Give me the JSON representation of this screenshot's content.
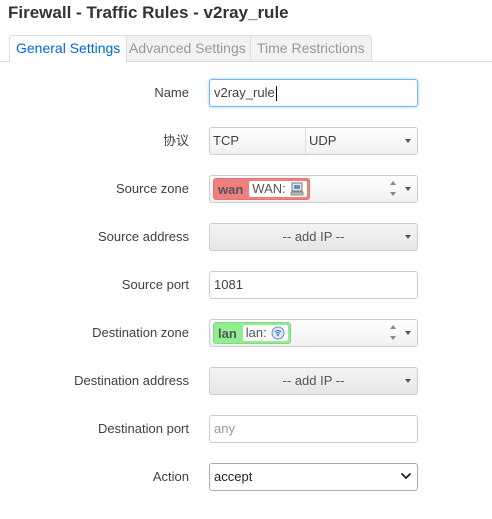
{
  "page": {
    "title": "Firewall - Traffic Rules - v2ray_rule"
  },
  "tabs": [
    {
      "label": "General Settings",
      "active": true
    },
    {
      "label": "Advanced Settings",
      "active": false
    },
    {
      "label": "Time Restrictions",
      "active": false
    }
  ],
  "form": {
    "name": {
      "label": "Name",
      "value": "v2ray_rule"
    },
    "protocol": {
      "label": "协议",
      "options": [
        "TCP",
        "UDP"
      ]
    },
    "source_zone": {
      "label": "Source zone",
      "zone": "wan",
      "networks": "WAN:",
      "icon": "network-port-icon",
      "color": "#f08080"
    },
    "source_address": {
      "label": "Source address",
      "value": "-- add IP --"
    },
    "source_port": {
      "label": "Source port",
      "value": "1081"
    },
    "destination_zone": {
      "label": "Destination zone",
      "zone": "lan",
      "networks": "lan:",
      "icon": "wireless-icon",
      "color": "#90ee90"
    },
    "destination_address": {
      "label": "Destination address",
      "value": "-- add IP --"
    },
    "destination_port": {
      "label": "Destination port",
      "placeholder": "any"
    },
    "action": {
      "label": "Action",
      "value": "accept"
    }
  }
}
